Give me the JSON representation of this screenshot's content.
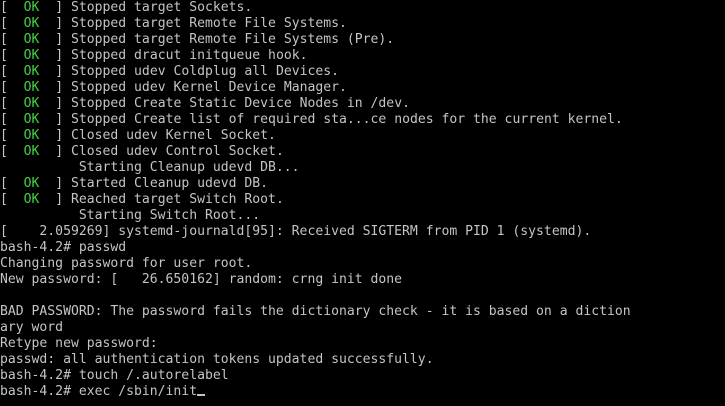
{
  "status_ok": "OK",
  "lines": [
    {
      "type": "status",
      "text": "Stopped target Sockets."
    },
    {
      "type": "status",
      "text": "Stopped target Remote File Systems."
    },
    {
      "type": "status",
      "text": "Stopped target Remote File Systems (Pre)."
    },
    {
      "type": "status",
      "text": "Stopped dracut initqueue hook."
    },
    {
      "type": "status",
      "text": "Stopped udev Coldplug all Devices."
    },
    {
      "type": "status",
      "text": "Stopped udev Kernel Device Manager."
    },
    {
      "type": "status",
      "text": "Stopped Create Static Device Nodes in /dev."
    },
    {
      "type": "status",
      "text": "Stopped Create list of required sta...ce nodes for the current kernel."
    },
    {
      "type": "status",
      "text": "Closed udev Kernel Socket."
    },
    {
      "type": "status",
      "text": "Closed udev Control Socket."
    },
    {
      "type": "plain",
      "text": "          Starting Cleanup udevd DB..."
    },
    {
      "type": "status",
      "text": "Started Cleanup udevd DB."
    },
    {
      "type": "status",
      "text": "Reached target Switch Root."
    },
    {
      "type": "plain",
      "text": "          Starting Switch Root..."
    },
    {
      "type": "plain",
      "text": "[    2.059269] systemd-journald[95]: Received SIGTERM from PID 1 (systemd)."
    },
    {
      "type": "plain",
      "text": "bash-4.2# passwd"
    },
    {
      "type": "plain",
      "text": "Changing password for user root."
    },
    {
      "type": "plain",
      "text": "New password: [   26.650162] random: crng init done"
    },
    {
      "type": "plain",
      "text": ""
    },
    {
      "type": "plain",
      "text": "BAD PASSWORD: The password fails the dictionary check - it is based on a diction"
    },
    {
      "type": "plain",
      "text": "ary word"
    },
    {
      "type": "plain",
      "text": "Retype new password:"
    },
    {
      "type": "plain",
      "text": "passwd: all authentication tokens updated successfully."
    },
    {
      "type": "plain",
      "text": "bash-4.2# touch /.autorelabel"
    },
    {
      "type": "prompt",
      "text": "bash-4.2# exec /sbin/init"
    }
  ],
  "colors": {
    "background": "#000000",
    "text": "#c4c4c4",
    "ok": "#3fd43f"
  }
}
